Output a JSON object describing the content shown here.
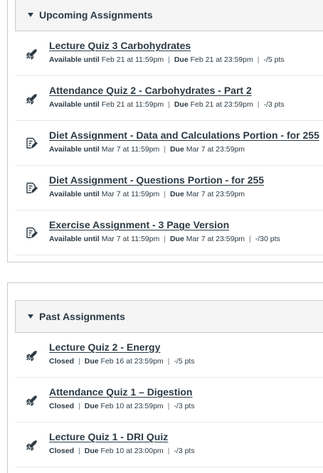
{
  "upcoming": {
    "title": "Upcoming Assignments",
    "items": [
      {
        "icon": "quiz-rocket-icon",
        "title": "Lecture Quiz 3 Carbohydrates",
        "available_label": "Available until",
        "available": "Feb 21 at 11:59pm",
        "due_label": "Due",
        "due": "Feb 21 at 23:59pm",
        "points": "-/5 pts"
      },
      {
        "icon": "quiz-rocket-icon",
        "title": "Attendance Quiz 2 - Carbohydrates - Part 2",
        "available_label": "Available until",
        "available": "Feb 21 at 11:59pm",
        "due_label": "Due",
        "due": "Feb 21 at 23:59pm",
        "points": "-/3 pts"
      },
      {
        "icon": "assignment-icon",
        "title": "Diet Assignment - Data and Calculations Portion - for 255",
        "available_label": "Available until",
        "available": "Mar 7 at 11:59pm",
        "due_label": "Due",
        "due": "Mar 7 at 23:59pm",
        "points": ""
      },
      {
        "icon": "assignment-icon",
        "title": "Diet Assignment - Questions Portion - for 255",
        "available_label": "Available until",
        "available": "Mar 7 at 11:59pm",
        "due_label": "Due",
        "due": "Mar 7 at 23:59pm",
        "points": ""
      },
      {
        "icon": "assignment-icon",
        "title": "Exercise Assignment - 3 Page Version",
        "available_label": "Available until",
        "available": "Mar 7 at 11:59pm",
        "due_label": "Due",
        "due": "Mar 7 at 23:59pm",
        "points": "-/30 pts"
      }
    ]
  },
  "past": {
    "title": "Past Assignments",
    "items": [
      {
        "icon": "quiz-rocket-icon",
        "title": "Lecture Quiz 2 - Energy",
        "status": "Closed",
        "due_label": "Due",
        "due": "Feb 16 at 23:59pm",
        "points": "-/5 pts"
      },
      {
        "icon": "quiz-rocket-icon",
        "title": "Attendance Quiz 1 – Digestion",
        "status": "Closed",
        "due_label": "Due",
        "due": "Feb 10 at 23:59pm",
        "points": "-/3 pts"
      },
      {
        "icon": "quiz-rocket-icon",
        "title": "Lecture Quiz 1 - DRI Quiz",
        "status": "Closed",
        "due_label": "Due",
        "due": "Feb 10 at 23:00pm",
        "points": "-/3 pts"
      }
    ]
  }
}
